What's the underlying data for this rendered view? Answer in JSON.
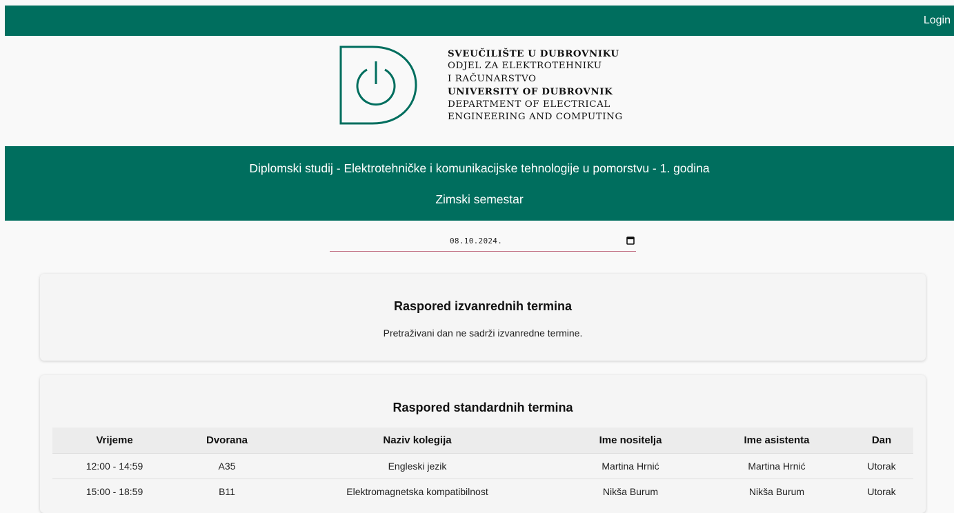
{
  "header": {
    "login_label": "Login"
  },
  "logo": {
    "line1": "SVEUČILIŠTE U DUBROVNIKU",
    "line2": "ODJEL ZA ELEKTROTEHNIKU",
    "line3": "I RAČUNARSTVO",
    "line4": "UNIVERSITY OF DUBROVNIK",
    "line5": "DEPARTMENT OF ELECTRICAL",
    "line6": "ENGINEERING AND COMPUTING"
  },
  "banner": {
    "program": "Diplomski studij - Elektrotehničke i komunikacijske tehnologije u pomorstvu - 1. godina",
    "semester": "Zimski semestar"
  },
  "date_picker": {
    "value": "08.10.2024.",
    "icon": "calendar-icon"
  },
  "extraordinary": {
    "title": "Raspored izvanrednih termina",
    "message": "Pretraživani dan ne sadrži izvanredne termine."
  },
  "standard": {
    "title": "Raspored standardnih termina",
    "columns": [
      "Vrijeme",
      "Dvorana",
      "Naziv kolegija",
      "Ime nositelja",
      "Ime asistenta",
      "Dan"
    ],
    "rows": [
      [
        "12:00 - 14:59",
        "A35",
        "Engleski jezik",
        "Martina Hrnić",
        "Martina Hrnić",
        "Utorak"
      ],
      [
        "15:00 - 18:59",
        "B11",
        "Elektromagnetska kompatibilnost",
        "Nikša Burum",
        "Nikša Burum",
        "Utorak"
      ]
    ]
  },
  "colors": {
    "brand": "#006e5e",
    "date_underline": "#c06a7f"
  }
}
